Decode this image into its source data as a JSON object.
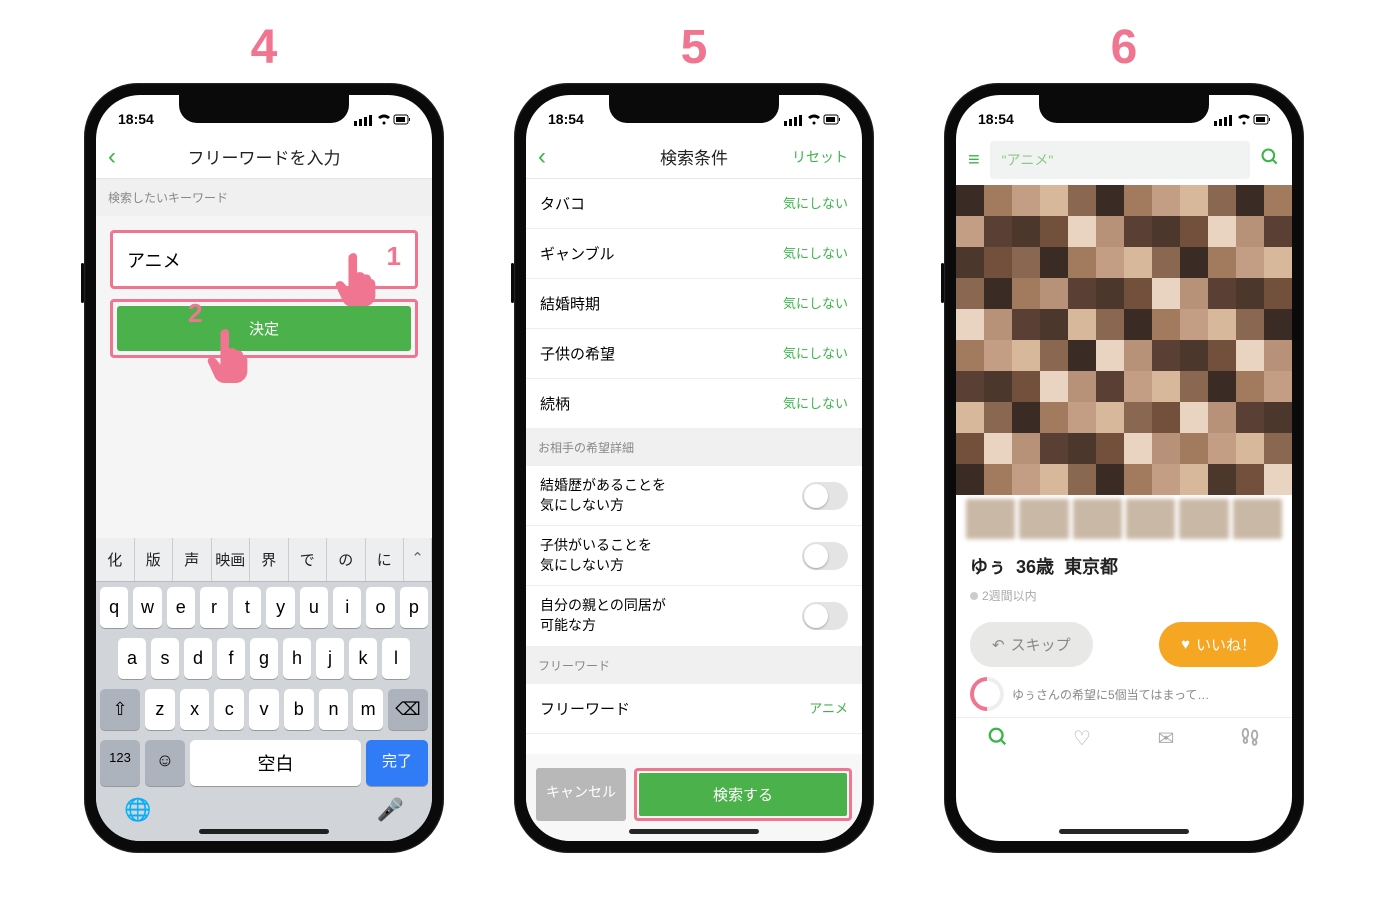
{
  "steps": [
    "4",
    "5",
    "6"
  ],
  "status_time": "18:54",
  "colors": {
    "accent": "#3bb54a",
    "highlight": "#f07590",
    "like": "#f5a623"
  },
  "screen4": {
    "title": "フリーワードを入力",
    "section": "検索したいキーワード",
    "input_value": "アニメ",
    "annot1": "1",
    "annot2": "2",
    "confirm": "決定",
    "suggestions": [
      "化",
      "版",
      "声",
      "映画",
      "界",
      "で",
      "の",
      "に"
    ],
    "keys_r1": [
      "q",
      "w",
      "e",
      "r",
      "t",
      "y",
      "u",
      "i",
      "o",
      "p"
    ],
    "keys_r2": [
      "a",
      "s",
      "d",
      "f",
      "g",
      "h",
      "j",
      "k",
      "l"
    ],
    "keys_r3": [
      "z",
      "x",
      "c",
      "v",
      "b",
      "n",
      "m"
    ],
    "key_123": "123",
    "key_space": "空白",
    "key_done": "完了"
  },
  "screen5": {
    "title": "検索条件",
    "reset": "リセット",
    "rows": [
      {
        "label": "タバコ",
        "value": "気にしない"
      },
      {
        "label": "ギャンブル",
        "value": "気にしない"
      },
      {
        "label": "結婚時期",
        "value": "気にしない"
      },
      {
        "label": "子供の希望",
        "value": "気にしない"
      },
      {
        "label": "続柄",
        "value": "気にしない"
      }
    ],
    "section2": "お相手の希望詳細",
    "toggles": [
      "結婚歴があることを\n気にしない方",
      "子供がいることを\n気にしない方",
      "自分の親との同居が\n可能な方"
    ],
    "section3": "フリーワード",
    "freeword_label": "フリーワード",
    "freeword_value": "アニメ",
    "cancel": "キャンセル",
    "search": "検索する"
  },
  "screen6": {
    "search_text": "\"アニメ\"",
    "name": "ゆぅ",
    "age": "36歳",
    "pref": "東京都",
    "presence": "2週間以内",
    "skip": "スキップ",
    "like": "いいね！",
    "meter_text": "ゆぅさんの希望に5個当てはまって…"
  }
}
